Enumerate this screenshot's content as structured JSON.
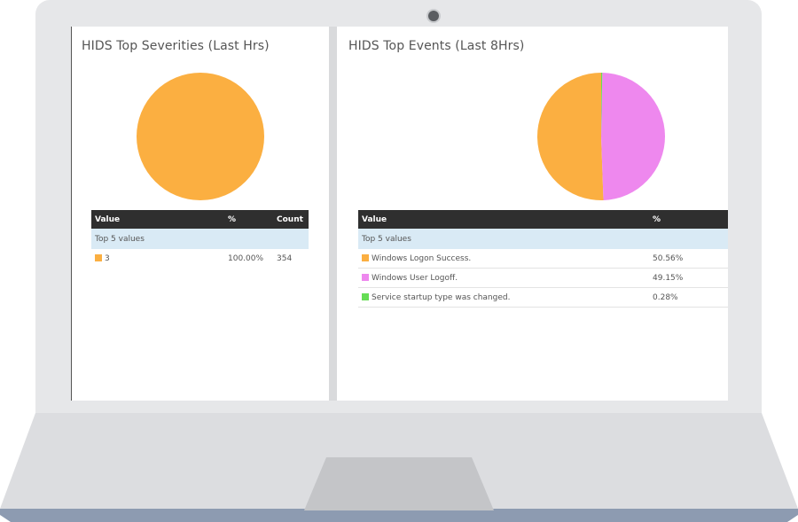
{
  "panels": [
    {
      "title": "HIDS Top Severities (Last Hrs)",
      "columns": [
        "Value",
        "%",
        "Count"
      ],
      "group_label": "Top 5 values",
      "rows": [
        {
          "value": "3",
          "percent": "100.00%",
          "count": "354",
          "color": "#fbaf41"
        }
      ],
      "chart_data": {
        "type": "pie",
        "slices": [
          {
            "label": "3",
            "value": 100.0,
            "color": "#fbaf41"
          }
        ]
      }
    },
    {
      "title": "HIDS Top Events (Last 8Hrs)",
      "columns": [
        "Value",
        "%"
      ],
      "group_label": "Top 5 values",
      "rows": [
        {
          "value": "Windows Logon Success.",
          "percent": "50.56%",
          "color": "#fbaf41"
        },
        {
          "value": "Windows User Logoff.",
          "percent": "49.15%",
          "color": "#ee88ee"
        },
        {
          "value": "Service startup type was changed.",
          "percent": "0.28%",
          "color": "#66dd55"
        }
      ],
      "chart_data": {
        "type": "pie",
        "slices": [
          {
            "label": "Windows Logon Success.",
            "value": 50.56,
            "color": "#fbaf41"
          },
          {
            "label": "Windows User Logoff.",
            "value": 49.15,
            "color": "#ee88ee"
          },
          {
            "label": "Service startup type was changed.",
            "value": 0.28,
            "color": "#66dd55"
          }
        ]
      }
    }
  ]
}
